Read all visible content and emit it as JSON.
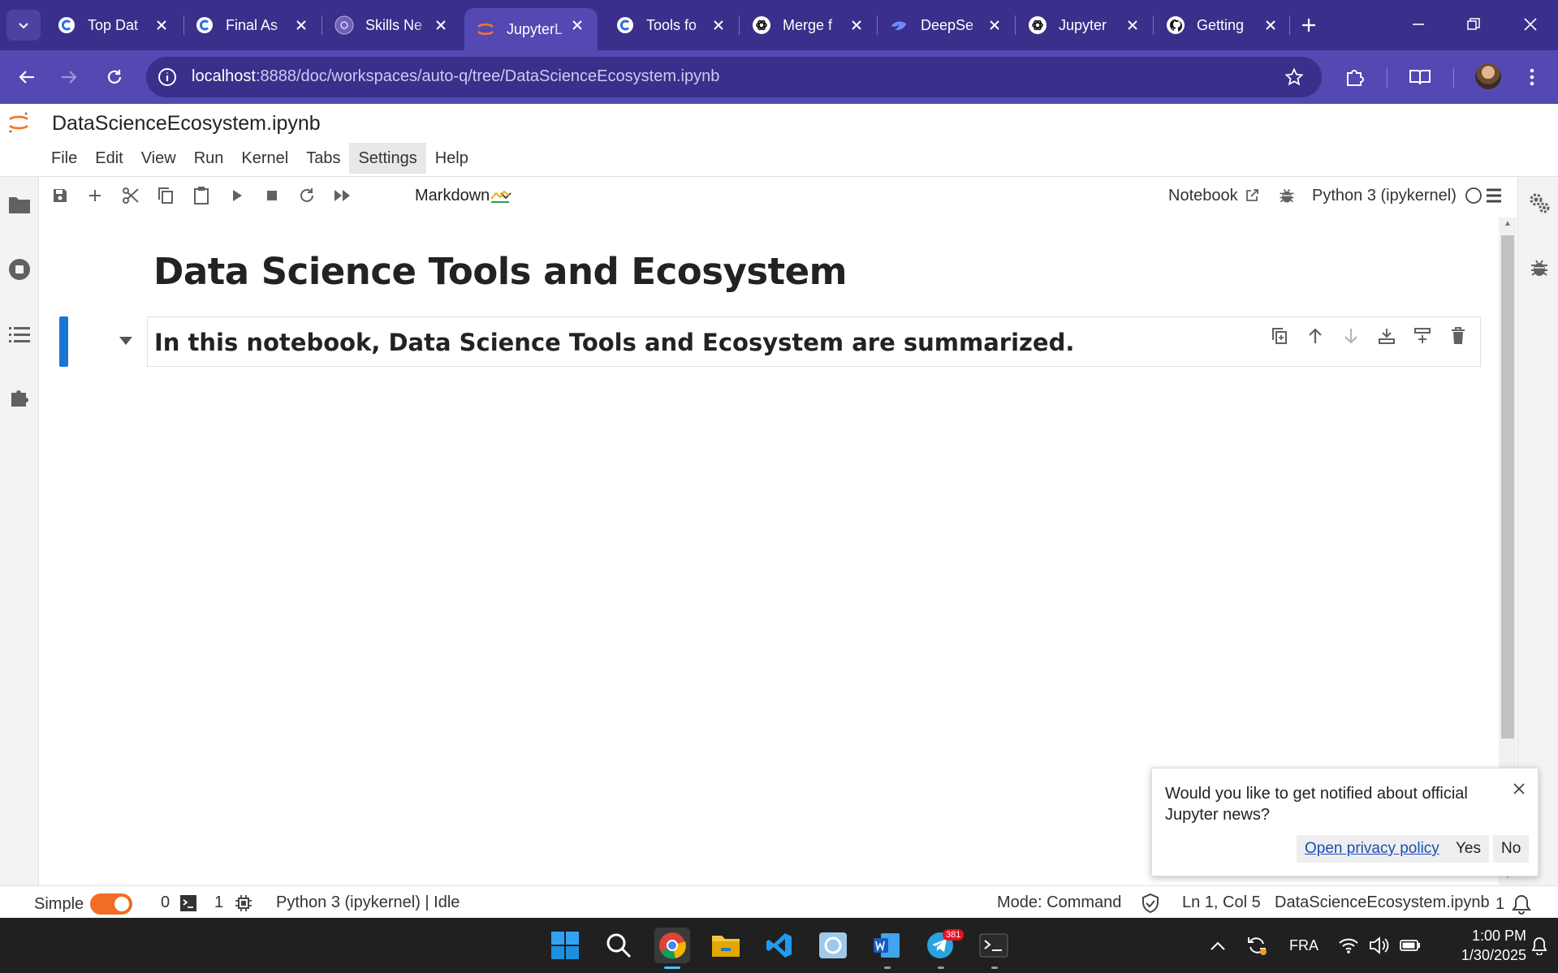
{
  "browser": {
    "tabs": [
      {
        "title": "Top Dat",
        "icon": "coursera-icon"
      },
      {
        "title": "Final As",
        "icon": "coursera-icon"
      },
      {
        "title": "Skills Ne",
        "icon": "skills-network-icon"
      },
      {
        "title": "JupyterL",
        "icon": "jupyter-icon",
        "active": true
      },
      {
        "title": "Tools fo",
        "icon": "coursera-icon"
      },
      {
        "title": "Merge f",
        "icon": "openai-icon"
      },
      {
        "title": "DeepSe",
        "icon": "deepseek-icon"
      },
      {
        "title": "Jupyter",
        "icon": "openai-icon"
      },
      {
        "title": "Getting",
        "icon": "github-icon"
      }
    ],
    "url_host": "localhost",
    "url_rest": ":8888/doc/workspaces/auto-q/tree/DataScienceEcosystem.ipynb"
  },
  "jupyter": {
    "doc_title": "DataScienceEcosystem.ipynb",
    "menu": [
      "File",
      "Edit",
      "View",
      "Run",
      "Kernel",
      "Tabs",
      "Settings",
      "Help"
    ],
    "cell_type": "Markdown",
    "notebook_label": "Notebook",
    "kernel_name": "Python 3 (ipykernel)"
  },
  "notebook": {
    "heading": "Data Science Tools and Ecosystem",
    "cell_text": "In this notebook, Data Science Tools and Ecosystem are summarized."
  },
  "notification": {
    "message": "Would you like to get notified about official Jupyter news?",
    "link": "Open privacy policy",
    "yes": "Yes",
    "no": "No"
  },
  "status": {
    "mode_label": "Simple",
    "terminals": "0",
    "kernels": "1",
    "kernel_status": "Python 3 (ipykernel) | Idle",
    "mode": "Mode: Command",
    "position": "Ln 1, Col 5",
    "filename": "DataScienceEcosystem.ipynb",
    "notifications": "1"
  },
  "taskbar": {
    "telegram_badge": "381",
    "language": "FRA",
    "time": "1:00 PM",
    "date": "1/30/2025"
  },
  "colors": {
    "browser_frame": "#3a2f8a",
    "browser_toolbar": "#5448b3",
    "jupyter_orange": "#f06d23",
    "active_cell": "#1976d2"
  }
}
